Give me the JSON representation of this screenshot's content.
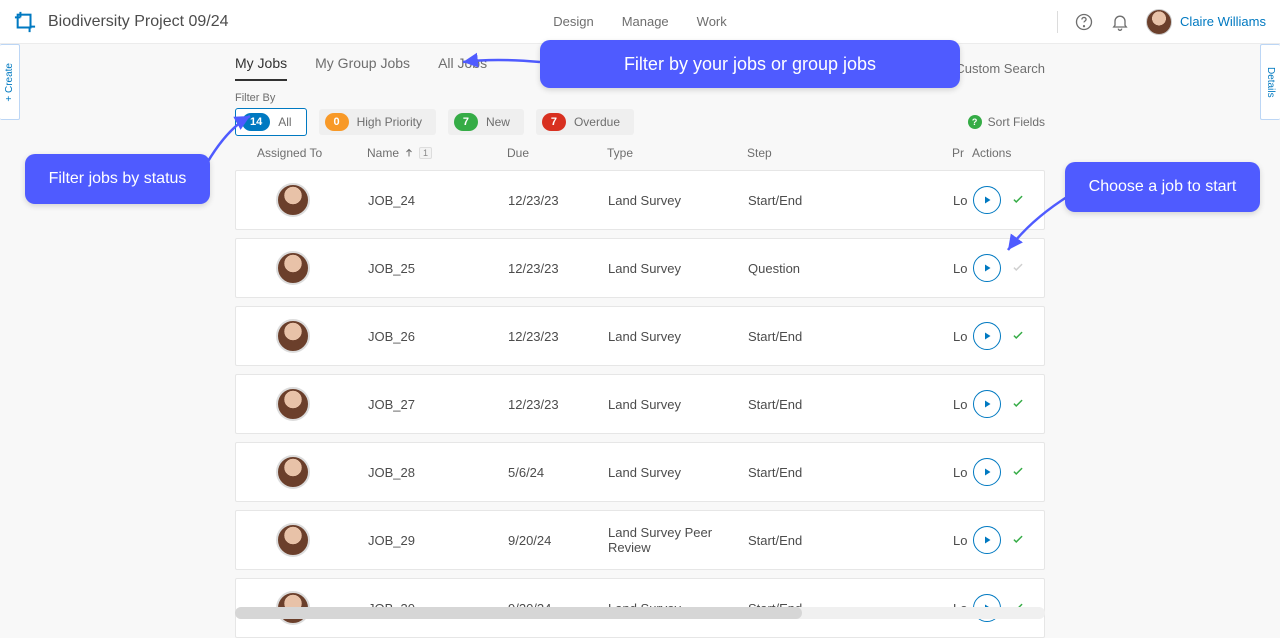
{
  "header": {
    "title": "Biodiversity Project 09/24",
    "nav": {
      "design": "Design",
      "manage": "Manage",
      "work": "Work"
    },
    "user_name": "Claire Williams"
  },
  "rails": {
    "left": "+ Create",
    "right": "Details"
  },
  "tabs": {
    "my": "My Jobs",
    "group": "My Group Jobs",
    "all": "All Jobs"
  },
  "search": {
    "label": "Custom Search"
  },
  "filter_by_label": "Filter By",
  "filters": {
    "all": {
      "count": "14",
      "label": "All"
    },
    "high": {
      "count": "0",
      "label": "High Priority"
    },
    "new": {
      "count": "7",
      "label": "New"
    },
    "overdue": {
      "count": "7",
      "label": "Overdue"
    }
  },
  "sort_fields_label": "Sort Fields",
  "columns": {
    "assigned": "Assigned To",
    "name": "Name",
    "sortnum": "1",
    "due": "Due",
    "type": "Type",
    "step": "Step",
    "pr": "Pr",
    "actions": "Actions"
  },
  "jobs": [
    {
      "name": "JOB_24",
      "due": "12/23/23",
      "type": "Land Survey",
      "step": "Start/End",
      "pr": "Lo",
      "check": true
    },
    {
      "name": "JOB_25",
      "due": "12/23/23",
      "type": "Land Survey",
      "step": "Question",
      "pr": "Lo",
      "check": false
    },
    {
      "name": "JOB_26",
      "due": "12/23/23",
      "type": "Land Survey",
      "step": "Start/End",
      "pr": "Lo",
      "check": true
    },
    {
      "name": "JOB_27",
      "due": "12/23/23",
      "type": "Land Survey",
      "step": "Start/End",
      "pr": "Lo",
      "check": true
    },
    {
      "name": "JOB_28",
      "due": "5/6/24",
      "type": "Land Survey",
      "step": "Start/End",
      "pr": "Lo",
      "check": true
    },
    {
      "name": "JOB_29",
      "due": "9/20/24",
      "type": "Land Survey Peer Review",
      "step": "Start/End",
      "pr": "Lo",
      "check": true
    },
    {
      "name": "JOB_30",
      "due": "9/20/24",
      "type": "Land Survey",
      "step": "Start/End",
      "pr": "Lo",
      "check": true
    }
  ],
  "annotations": {
    "top": "Filter by your jobs or group jobs",
    "left": "Filter jobs by status",
    "right": "Choose a job to start"
  }
}
